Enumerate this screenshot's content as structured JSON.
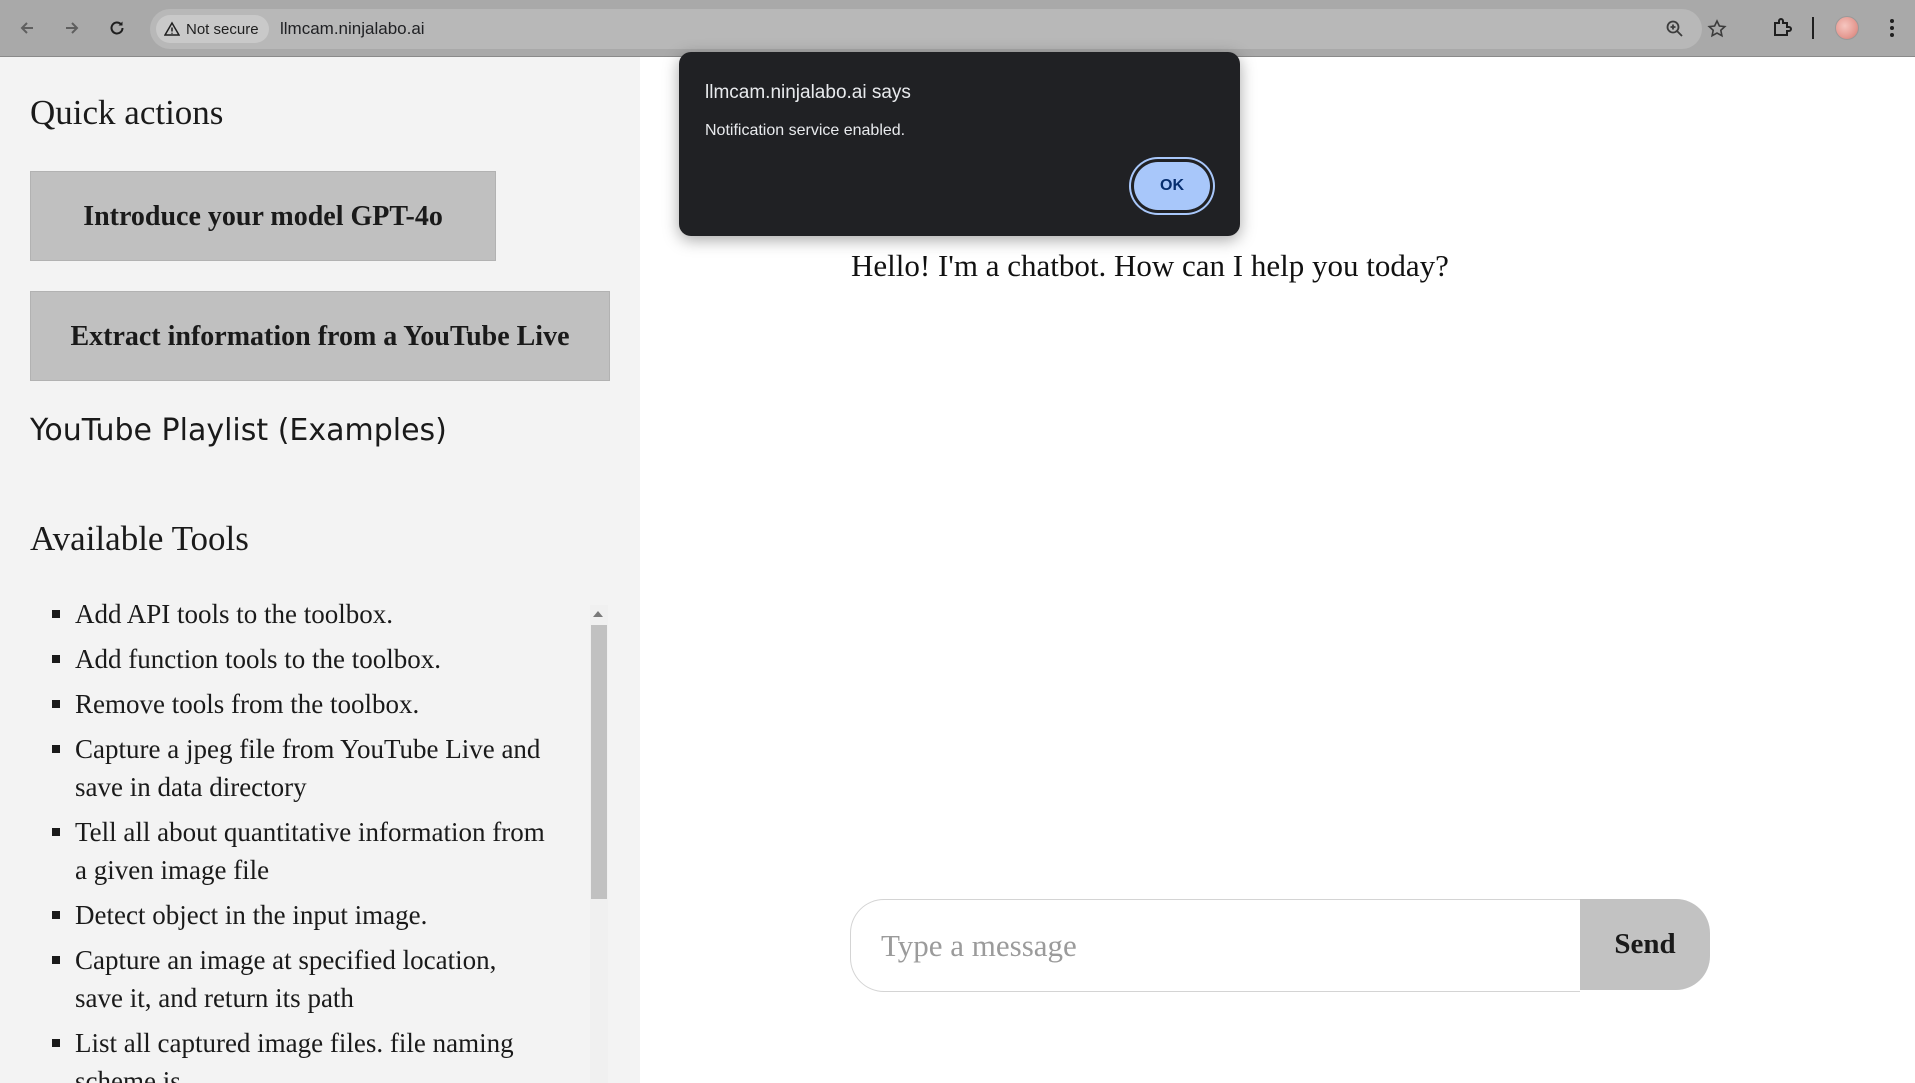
{
  "browser": {
    "security_label": "Not secure",
    "url": "llmcam.ninjalabo.ai"
  },
  "sidebar": {
    "quick_actions_title": "Quick actions",
    "quick_actions": [
      "Introduce your model GPT-4o",
      "Extract information from a YouTube Live"
    ],
    "playlist_title": "YouTube Playlist (Examples)",
    "tools_title": "Available Tools",
    "tools": [
      "Add API tools to the toolbox.",
      "Add function tools to the toolbox.",
      "Remove tools from the toolbox.",
      "Capture a jpeg file from YouTube Live and save in data directory",
      "Tell all about quantitative information from a given image file",
      "Detect object in the input image.",
      "Capture an image at specified location, save it, and return its path",
      "List all captured image files. file naming scheme is"
    ]
  },
  "chat": {
    "greeting": "Hello! I'm a chatbot. How can I help you today?",
    "input_placeholder": "Type a message",
    "send_label": "Send"
  },
  "alert": {
    "title": "llmcam.ninjalabo.ai says",
    "message": "Notification service enabled.",
    "ok_label": "OK"
  },
  "colors": {
    "chrome_bar": "#a9a9a9",
    "sidebar_bg": "#f3f3f3",
    "button_bg": "#c0c0c0",
    "alert_bg": "#202124",
    "alert_ok_bg": "#a8c7fa"
  }
}
